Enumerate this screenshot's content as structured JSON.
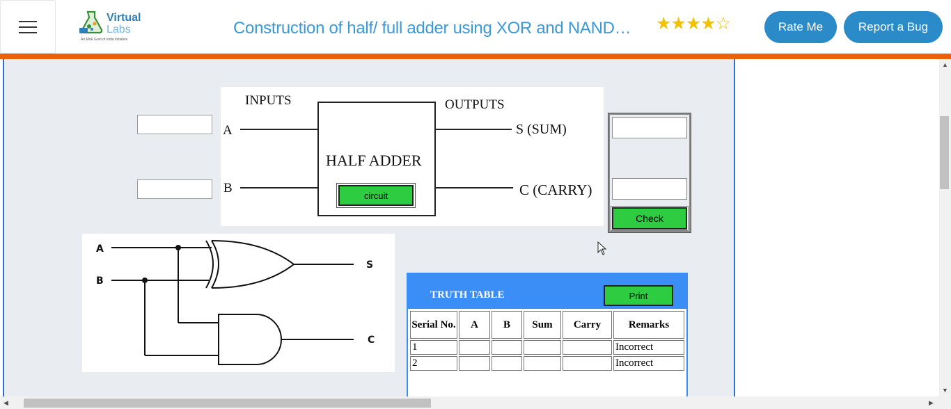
{
  "header": {
    "menu_icon": "hamburger-menu-icon",
    "logo": {
      "line1": "Virtual",
      "line2": "Labs",
      "tagline": "An MoE Govt of India Initiative"
    },
    "title": "Construction of half/ full adder using XOR and NAND…",
    "rating": {
      "value": 4,
      "max": 5,
      "filled": "★★★★",
      "empty": "☆"
    },
    "rate_button": "Rate Me",
    "bug_button": "Report a Bug",
    "colors": {
      "accent": "#2a8bc8",
      "title": "#3a9ad9",
      "bar": "#e8620b",
      "star": "#f2c200"
    }
  },
  "simulator": {
    "input_a_value": "",
    "input_b_value": "",
    "half_adder": {
      "inputs_label": "INPUTS",
      "outputs_label": "OUTPUTS",
      "a_label": "A",
      "b_label": "B",
      "box_label": "HALF ADDER",
      "sum_label": "S (SUM)",
      "carry_label": "C (CARRY)",
      "circuit_button": "circuit"
    },
    "output_sum_value": "",
    "output_carry_value": "",
    "check_button": "Check",
    "gate_diagram": {
      "a_label": "A",
      "b_label": "B",
      "s_label": "S",
      "c_label": "C"
    },
    "truth_table": {
      "title": "TRUTH TABLE",
      "print_button": "Print",
      "headers": [
        "Serial No.",
        "A",
        "B",
        "Sum",
        "Carry",
        "Remarks"
      ],
      "rows": [
        {
          "serial": "1",
          "a": "",
          "b": "",
          "sum": "",
          "carry": "",
          "remarks": "Incorrect"
        },
        {
          "serial": "2",
          "a": "",
          "b": "",
          "sum": "",
          "carry": "",
          "remarks": "Incorrect"
        }
      ]
    },
    "colors": {
      "button_green": "#2ecc40",
      "panel_blue": "#3c8ef7",
      "frame_border": "#2b6fd6"
    }
  }
}
